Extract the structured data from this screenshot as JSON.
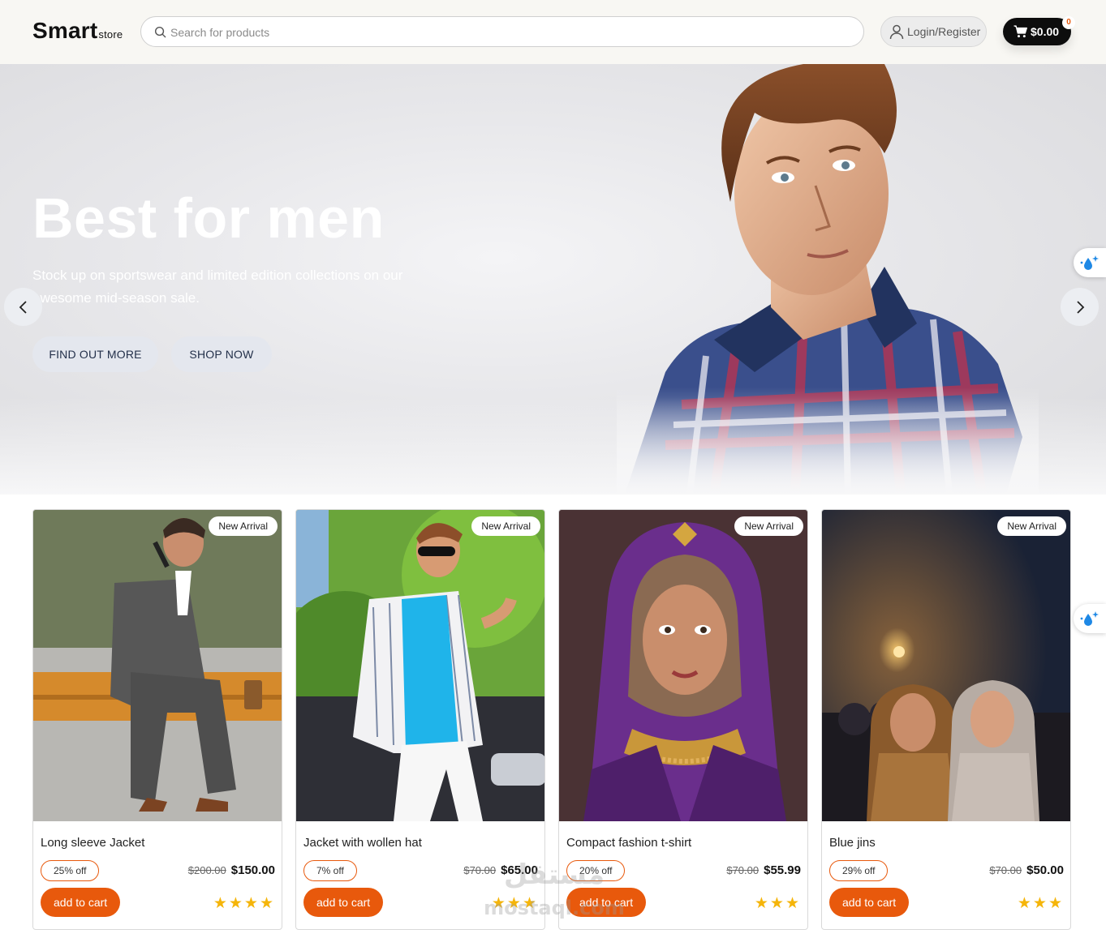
{
  "header": {
    "logo_main": "Smart",
    "logo_sub": "store",
    "search_placeholder": "Search for products",
    "login_label": "Login/Register",
    "cart_total": "$0.00",
    "cart_count": "0"
  },
  "hero": {
    "title": "Best for men",
    "subtitle": "Stock up on sportswear and limited edition collections on our awesome mid-season sale.",
    "btn_find_out_more": "FIND OUT MORE",
    "btn_shop_now": "SHOP NOW"
  },
  "products": [
    {
      "badge": "New Arrival",
      "title": "Long sleeve Jacket",
      "discount": "25% off",
      "old_price": "$200.00",
      "price": "$150.00",
      "cta": "add to cart",
      "stars": "★★★★",
      "rating": 4
    },
    {
      "badge": "New Arrival",
      "title": "Jacket with wollen hat",
      "discount": "7% off",
      "old_price": "$70.00",
      "price": "$65.00",
      "cta": "add to cart",
      "stars": "★★★",
      "rating": 3
    },
    {
      "badge": "New Arrival",
      "title": "Compact fashion t-shirt",
      "discount": "20% off",
      "old_price": "$70.00",
      "price": "$55.99",
      "cta": "add to cart",
      "stars": "★★★",
      "rating": 3
    },
    {
      "badge": "New Arrival",
      "title": "Blue jins",
      "discount": "29% off",
      "old_price": "$70.00",
      "price": "$50.00",
      "cta": "add to cart",
      "stars": "★★★",
      "rating": 3
    }
  ],
  "watermark": {
    "text_ar": "مستقل",
    "text_en": "mostaql.com"
  },
  "colors": {
    "accent": "#e8590c",
    "star": "#f5b50a",
    "cart_bg": "#0d0d0d",
    "header_bg": "#f8f7f3"
  },
  "icons": [
    "search-icon",
    "user-icon",
    "cart-icon",
    "chevron-left-icon",
    "chevron-right-icon",
    "droplet-sparkle-icon"
  ]
}
